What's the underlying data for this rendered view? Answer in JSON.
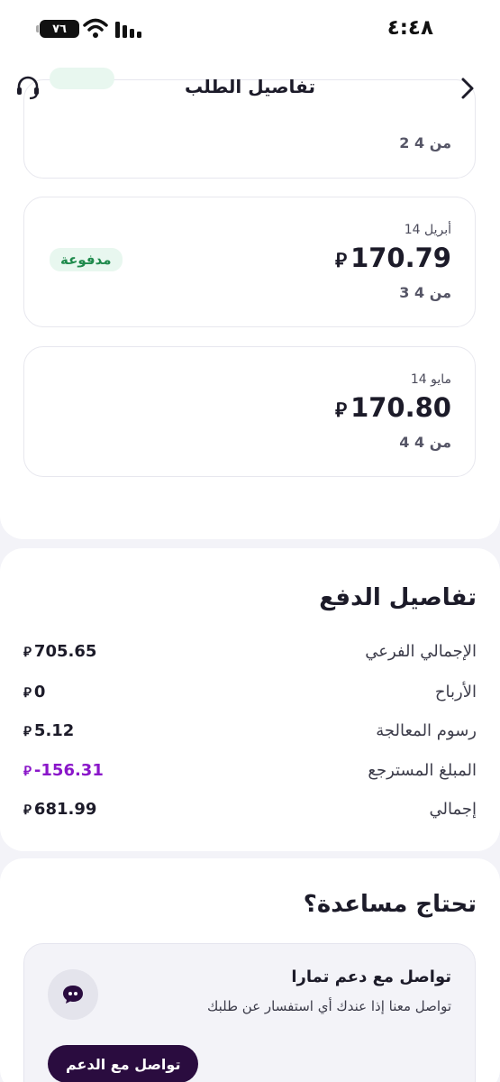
{
  "status_bar": {
    "time": "٤:٤٨",
    "battery": "٧٦"
  },
  "header": {
    "title": "تفاصيل الطلب"
  },
  "installments": [
    {
      "count": "2 من 4",
      "status": ""
    },
    {
      "date": "14 أبريل",
      "amount": "170.79",
      "currency": "⃁",
      "count": "3 من 4",
      "status": "مدفوعة"
    },
    {
      "date": "14 مايو",
      "amount": "170.80",
      "currency": "⃁",
      "count": "4 من 4",
      "status": ""
    }
  ],
  "payment_details": {
    "title": "تفاصيل الدفع",
    "rows": [
      {
        "label": "الإجمالي الفرعي",
        "value": "705.65",
        "currency": "⃁"
      },
      {
        "label": "الأرباح",
        "value": "0",
        "currency": "⃁"
      },
      {
        "label": "رسوم المعالجة",
        "value": "5.12",
        "currency": "⃁"
      },
      {
        "label": "المبلغ المسترجع",
        "value": "-156.31",
        "currency": "⃁"
      },
      {
        "label": "إجمالي",
        "value": "681.99",
        "currency": "⃁"
      }
    ]
  },
  "help": {
    "title": "تحتاج مساعدة؟",
    "contact_title": "تواصل مع دعم تمارا",
    "contact_subtitle": "تواصل معنا إذا عندك أي استفسار عن طلبك",
    "button_label": "تواصل مع الدعم"
  },
  "colors": {
    "accent": "#2a0c3f",
    "paid_green": "#1f8a4c",
    "refund_purple": "#8a16c9"
  }
}
